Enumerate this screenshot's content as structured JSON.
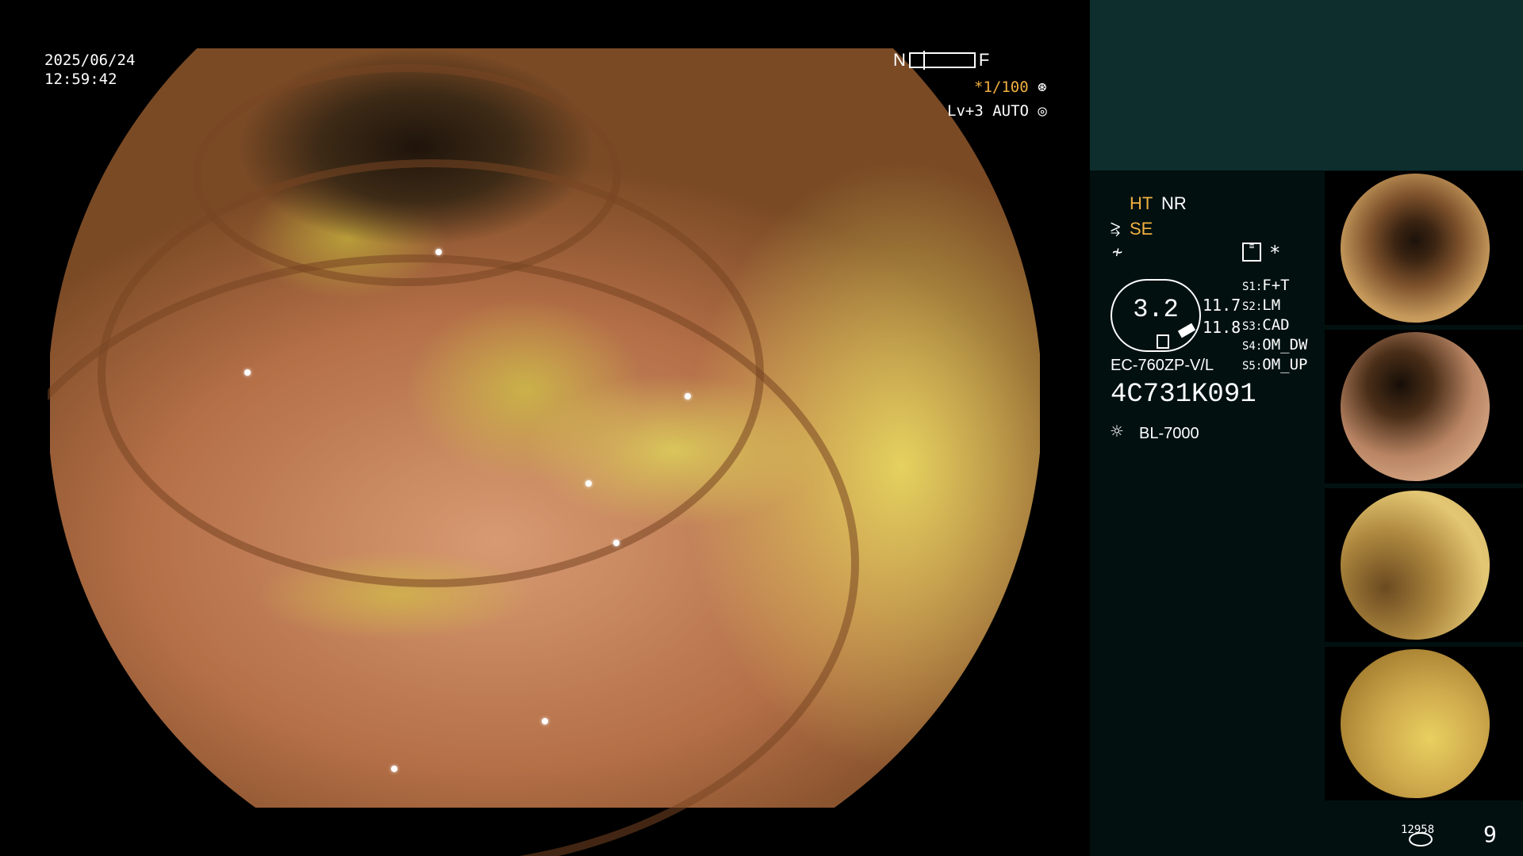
{
  "overlay": {
    "date": "2025/06/24",
    "time": "12:59:42",
    "near_label": "N",
    "far_label": "F",
    "shutter": "*1/100",
    "level": "Lv+3 AUTO"
  },
  "panel": {
    "ht": "HT",
    "nr": "NR",
    "se": "SE",
    "gauge_value": "3.2",
    "gauge_reading_1": "11.7",
    "gauge_reading_2": "11.8",
    "scope_settings": [
      {
        "key": "S1:",
        "value": "F+T"
      },
      {
        "key": "S2:",
        "value": "LM"
      },
      {
        "key": "S3:",
        "value": "CAD"
      },
      {
        "key": "S4:",
        "value": "OM_DW"
      },
      {
        "key": "S5:",
        "value": "OM_UP"
      }
    ],
    "model": "EC-760ZP-V/L",
    "serial": "4C731K091",
    "light_source": "BL-7000"
  },
  "footer": {
    "image_count": "12958",
    "page": "9"
  },
  "icons": {
    "shutter": "aperture-icon",
    "level": "auto-iris-icon",
    "structure": "scissor-icon",
    "freeze": "freeze-icon",
    "memory": "memory-icon",
    "lamp": "lamp-icon",
    "storage": "disk-icon"
  },
  "colors": {
    "accent": "#f0b040",
    "panel_bg": "#021010",
    "panel_header": "#0e2e2e"
  }
}
